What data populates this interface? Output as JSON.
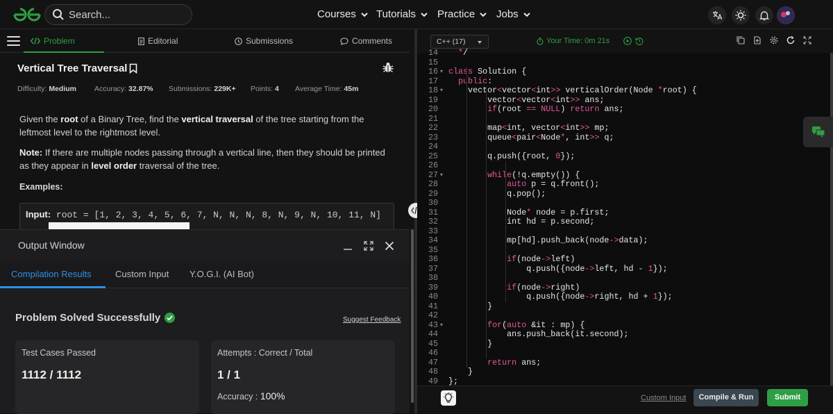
{
  "header": {
    "logo_icon": "gfg-logo-icon",
    "search_placeholder": "Search...",
    "nav": [
      "Courses",
      "Tutorials",
      "Practice",
      "Jobs"
    ]
  },
  "tabs": {
    "problem": "Problem",
    "editorial": "Editorial",
    "submissions": "Submissions",
    "comments": "Comments"
  },
  "problem": {
    "title": "Vertical Tree Traversal",
    "difficulty_label": "Difficulty:",
    "difficulty": "Medium",
    "accuracy_label": "Accuracy:",
    "accuracy": "32.87%",
    "submissions_label": "Submissions:",
    "submissions": "229K+",
    "points_label": "Points:",
    "points": "4",
    "avg_time_label": "Average Time:",
    "avg_time": "45m",
    "desc1_a": "Given the ",
    "desc1_b": "root",
    "desc1_c": " of a Binary Tree, find the ",
    "desc1_d": "vertical traversal",
    "desc1_e": " of the tree starting from the leftmost level to the rightmost level.",
    "desc2_a": "Note:",
    "desc2_b": " If there are multiple nodes passing through a vertical line, then they should be printed as they appear in ",
    "desc2_c": "level order",
    "desc2_d": " traversal of the tree.",
    "examples": "Examples:",
    "input_label": "Input:",
    "input_value": " root = [1, 2, 3, 4, 5, 6, 7, N, N, N, 8, N, 9, N, 10, 11, N]"
  },
  "output": {
    "title": "Output Window",
    "tabs": [
      "Compilation Results",
      "Custom Input",
      "Y.O.G.I. (AI Bot)"
    ],
    "status": "Problem Solved Successfully",
    "suggest": "Suggest Feedback",
    "tc_label": "Test Cases Passed",
    "tc_value": "1112 / 1112",
    "att_label": "Attempts : Correct / Total",
    "att_value": "1 / 1",
    "acc_label": "Accuracy : ",
    "acc_value": "100%"
  },
  "editor": {
    "language": "C++ (17)",
    "timer": "Your Time: 0m 21s",
    "custom_input": "Custom Input",
    "compile_run": "Compile & Run",
    "submit": "Submit",
    "lines": [
      {
        "n": "14",
        "t": "  */"
      },
      {
        "n": "15",
        "t": ""
      },
      {
        "n": "16",
        "t": "class Solution {",
        "fold": true
      },
      {
        "n": "17",
        "t": "  public:"
      },
      {
        "n": "18",
        "t": "    vector<vector<int>> verticalOrder(Node *root) {",
        "fold": true
      },
      {
        "n": "19",
        "t": "        vector<vector<int>> ans;"
      },
      {
        "n": "20",
        "t": "        if(root == NULL) return ans;"
      },
      {
        "n": "21",
        "t": ""
      },
      {
        "n": "22",
        "t": "        map<int, vector<int>> mp;"
      },
      {
        "n": "23",
        "t": "        queue<pair<Node*, int>> q;"
      },
      {
        "n": "24",
        "t": ""
      },
      {
        "n": "25",
        "t": "        q.push({root, 0});"
      },
      {
        "n": "26",
        "t": ""
      },
      {
        "n": "27",
        "t": "        while(!q.empty()) {",
        "fold": true
      },
      {
        "n": "28",
        "t": "            auto p = q.front();"
      },
      {
        "n": "29",
        "t": "            q.pop();"
      },
      {
        "n": "30",
        "t": ""
      },
      {
        "n": "31",
        "t": "            Node* node = p.first;"
      },
      {
        "n": "32",
        "t": "            int hd = p.second;"
      },
      {
        "n": "33",
        "t": ""
      },
      {
        "n": "34",
        "t": "            mp[hd].push_back(node->data);"
      },
      {
        "n": "35",
        "t": ""
      },
      {
        "n": "36",
        "t": "            if(node->left)"
      },
      {
        "n": "37",
        "t": "                q.push({node->left, hd - 1});"
      },
      {
        "n": "38",
        "t": ""
      },
      {
        "n": "39",
        "t": "            if(node->right)"
      },
      {
        "n": "40",
        "t": "                q.push({node->right, hd + 1});"
      },
      {
        "n": "41",
        "t": "        }"
      },
      {
        "n": "42",
        "t": ""
      },
      {
        "n": "43",
        "t": "        for(auto &it : mp) {",
        "fold": true
      },
      {
        "n": "44",
        "t": "            ans.push_back(it.second);"
      },
      {
        "n": "45",
        "t": "        }"
      },
      {
        "n": "46",
        "t": ""
      },
      {
        "n": "47",
        "t": "        return ans;"
      },
      {
        "n": "48",
        "t": "    }"
      },
      {
        "n": "49",
        "t": "};"
      }
    ]
  },
  "colors": {
    "accent_green": "#2f9e44",
    "accent_blue": "#2e8fe6",
    "keyword_pink": "#e5589c"
  }
}
